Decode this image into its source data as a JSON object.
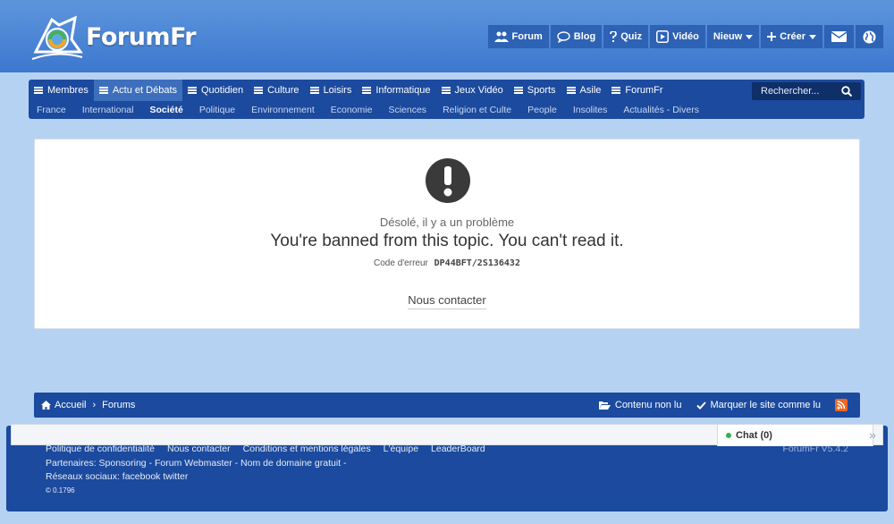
{
  "brand": {
    "name": "ForumFr"
  },
  "topnav": {
    "forum": "Forum",
    "blog": "Blog",
    "quiz": "Quiz",
    "video": "Vidéo",
    "new": "Nieuw",
    "create": "Créer"
  },
  "mainnav": {
    "items": [
      {
        "label": "Membres"
      },
      {
        "label": "Actu et Débats"
      },
      {
        "label": "Quotidien"
      },
      {
        "label": "Culture"
      },
      {
        "label": "Loisirs"
      },
      {
        "label": "Informatique"
      },
      {
        "label": "Jeux Vidéo"
      },
      {
        "label": "Sports"
      },
      {
        "label": "Asile"
      },
      {
        "label": "ForumFr"
      }
    ],
    "search_placeholder": "Rechercher...",
    "subitems": [
      {
        "label": "France"
      },
      {
        "label": "International"
      },
      {
        "label": "Société"
      },
      {
        "label": "Politique"
      },
      {
        "label": "Environnement"
      },
      {
        "label": "Economie"
      },
      {
        "label": "Sciences"
      },
      {
        "label": "Religion et Culte"
      },
      {
        "label": "People"
      },
      {
        "label": "Insolites"
      },
      {
        "label": "Actualités - Divers"
      }
    ]
  },
  "error": {
    "subtitle": "Désolé, il y a un problème",
    "message": "You're banned from this topic. You can't read it.",
    "code_label": "Code d'erreur",
    "code": "DP44BFT/2S136432",
    "contact": "Nous contacter"
  },
  "breadcrumb": {
    "home": "Accueil",
    "sep": "›",
    "forums": "Forums",
    "unread": "Contenu non lu",
    "mark_read": "Marquer le site comme lu"
  },
  "footer": {
    "links": [
      "Politique de confidentialité",
      "Nous contacter",
      "Conditions et mentions légales",
      "L'équipe",
      "LeaderBoard"
    ],
    "partners": "Partenaires: Sponsoring - Forum Webmaster - Nom de domaine gratuit -",
    "social": "Réseaux sociaux: facebook twitter",
    "version": "ForumFr V5.4.2",
    "copyright": "© 0.1796"
  },
  "chat": {
    "label": "Chat (0)"
  },
  "colors": {
    "header": "#3d78cf",
    "nav": "#1b4a9e",
    "page_bg": "#b6d2f2",
    "rss": "#f26522",
    "online": "#2fb54a"
  }
}
